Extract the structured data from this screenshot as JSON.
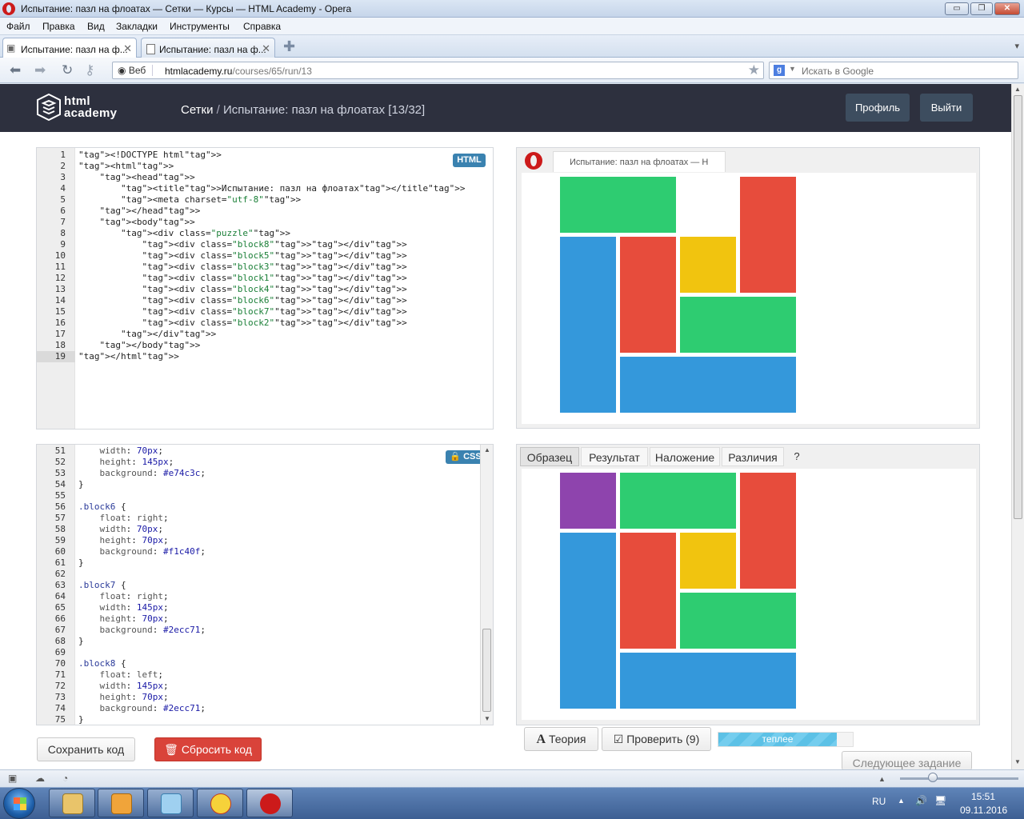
{
  "window": {
    "title": "Испытание: пазл на флоатах — Сетки — Курсы — HTML Academy - Opera",
    "controls": [
      "▭",
      "❐",
      "✕"
    ]
  },
  "menu": [
    "Файл",
    "Правка",
    "Вид",
    "Закладки",
    "Инструменты",
    "Справка"
  ],
  "tabs": [
    {
      "label": "Испытание: пазл на ф...",
      "close": "✕"
    },
    {
      "label": "Испытание: пазл на ф...",
      "close": "✕"
    }
  ],
  "address": {
    "web_label": "Веб",
    "host": "htmlacademy.ru",
    "path": "/courses/65/run/13",
    "search_placeholder": "Искать в Google"
  },
  "site": {
    "logo_line1": "html",
    "logo_line2": "academy",
    "breadcrumb_section": "Сетки",
    "breadcrumb_sep": " / ",
    "breadcrumb_current": "Испытание: пазл на флоатах [13/32]",
    "profile_btn": "Профиль",
    "logout_btn": "Выйти"
  },
  "html_editor": {
    "badge": "HTML",
    "active_line": 19,
    "lines": [
      "<!DOCTYPE html>",
      "<html>",
      "    <head>",
      "        <title>Испытание: пазл на флоатах</title>",
      "        <meta charset=\"utf-8\">",
      "    </head>",
      "    <body>",
      "        <div class=\"puzzle\">",
      "            <div class=\"block8\"></div>",
      "            <div class=\"block5\"></div>",
      "            <div class=\"block3\"></div>",
      "            <div class=\"block1\"></div>",
      "            <div class=\"block4\"></div>",
      "            <div class=\"block6\"></div>",
      "            <div class=\"block7\"></div>",
      "            <div class=\"block2\"></div>",
      "        </div>",
      "    </body>",
      "</html>"
    ]
  },
  "css_editor": {
    "badge": "CSS",
    "first_line": 51,
    "lines": [
      "    width: 70px;",
      "    height: 145px;",
      "    background: #e74c3c;",
      "}",
      "",
      ".block6 {",
      "    float: right;",
      "    width: 70px;",
      "    height: 70px;",
      "    background: #f1c40f;",
      "}",
      "",
      ".block7 {",
      "    float: right;",
      "    width: 145px;",
      "    height: 70px;",
      "    background: #2ecc71;",
      "}",
      "",
      ".block8 {",
      "    float: left;",
      "    width: 145px;",
      "    height: 70px;",
      "    background: #2ecc71;",
      "}"
    ]
  },
  "preview": {
    "tab_title": "Испытание: пазл на флоатах — Н"
  },
  "compare": {
    "tabs": [
      "Образец",
      "Результат",
      "Наложение",
      "Различия"
    ],
    "active": "Образец",
    "help": "?"
  },
  "colors": {
    "green": "#2ecc71",
    "red": "#e74c3c",
    "yellow": "#f1c40f",
    "blue": "#3498db",
    "purple": "#8e44ad"
  },
  "actions": {
    "save": "Сохранить код",
    "reset": "Сбросить код",
    "theory": "Теория",
    "check": "Проверить (9)",
    "progress_label": "теплее",
    "progress_value": 0.87,
    "next": "Следующее задание"
  },
  "taskbar": {
    "lang": "RU",
    "time": "15:51",
    "date": "09.11.2016"
  },
  "icons": [
    "opera-icon",
    "back-icon",
    "forward-icon",
    "reload-icon",
    "key-icon",
    "star-icon",
    "google-icon",
    "lock-icon",
    "trash-icon",
    "check-icon",
    "theory-icon",
    "windows-start-icon"
  ]
}
